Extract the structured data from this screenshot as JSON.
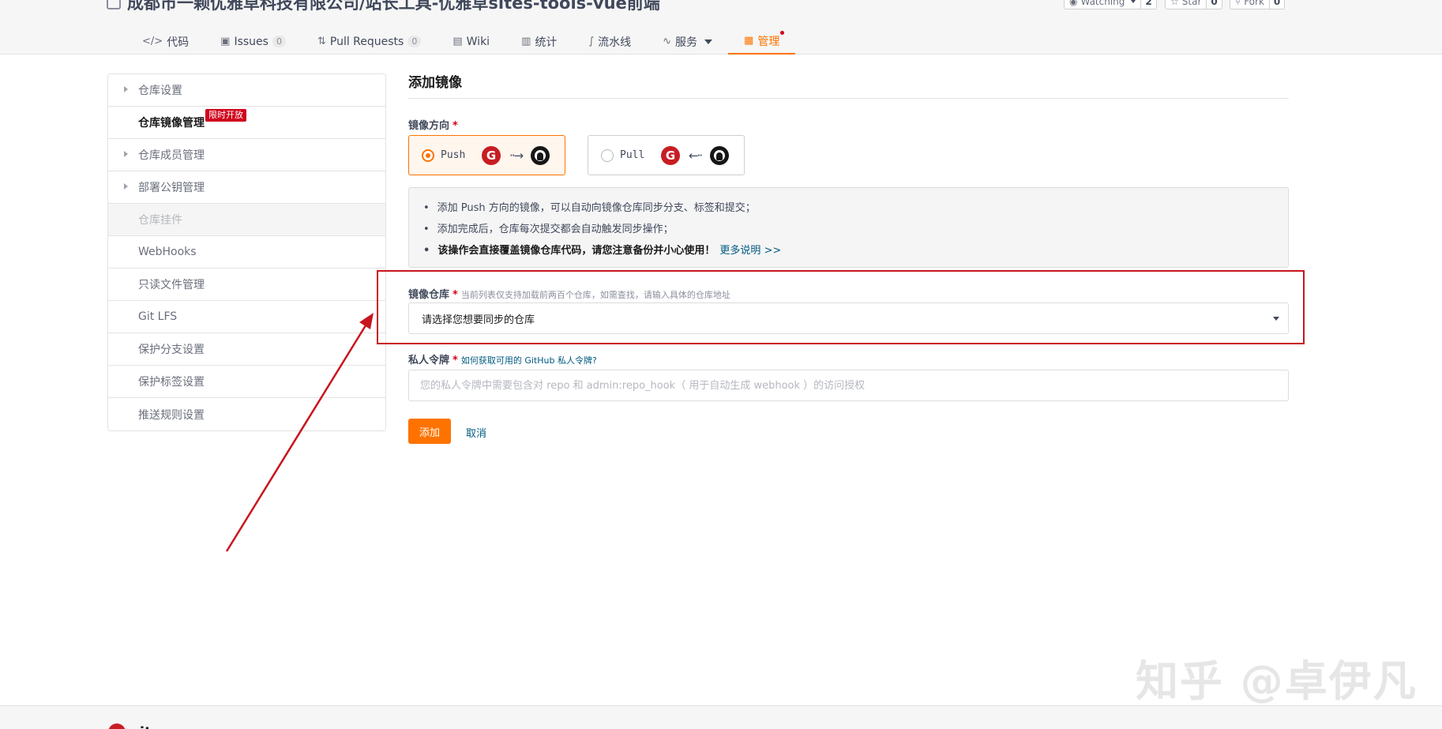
{
  "header": {
    "repo_title": "成都市一颗优雅草科技有限公司/站长工具-优雅草sites-tools-vue前端",
    "watching": {
      "label": "Watching",
      "count": "2"
    },
    "star": {
      "label": "Star",
      "count": "0"
    },
    "fork": {
      "label": "Fork",
      "count": "0"
    }
  },
  "tabs": [
    {
      "label": "代码",
      "icon": "code-icon"
    },
    {
      "label": "Issues",
      "icon": "issues-icon",
      "count": "0"
    },
    {
      "label": "Pull Requests",
      "icon": "pull-request-icon",
      "count": "0"
    },
    {
      "label": "Wiki",
      "icon": "wiki-icon"
    },
    {
      "label": "统计",
      "icon": "stats-icon"
    },
    {
      "label": "流水线",
      "icon": "pipeline-icon"
    },
    {
      "label": "服务",
      "icon": "service-icon"
    },
    {
      "label": "管理",
      "icon": "manage-icon",
      "active": true
    }
  ],
  "sidebar": {
    "items": [
      {
        "label": "仓库设置"
      },
      {
        "label": "仓库镜像管理",
        "badge": "限时开放"
      },
      {
        "label": "仓库成员管理"
      },
      {
        "label": "部署公钥管理"
      },
      {
        "label": "仓库挂件"
      },
      {
        "label": "WebHooks"
      },
      {
        "label": "只读文件管理"
      },
      {
        "label": "Git LFS"
      },
      {
        "label": "保护分支设置"
      },
      {
        "label": "保护标签设置"
      },
      {
        "label": "推送规则设置"
      }
    ]
  },
  "main": {
    "title": "添加镜像",
    "direction_label": "镜像方向",
    "push_label": "Push",
    "pull_label": "Pull",
    "info": [
      "添加 Push 方向的镜像，可以自动向镜像仓库同步分支、标签和提交；",
      "添加完成后，仓库每次提交都会自动触发同步操作；",
      "该操作会直接覆盖镜像仓库代码，请您注意备份并小心使用！"
    ],
    "info_more": "更多说明 >>",
    "repo_label": "镜像仓库",
    "repo_hint": "当前列表仅支持加载前两百个仓库，如需查找，请输入具体的仓库地址",
    "repo_select_value": "请选择您想要同步的仓库",
    "token_label": "私人令牌",
    "token_hint": "如何获取可用的 GitHub 私人令牌?",
    "token_placeholder": "您的私人令牌中需要包含对 repo 和 admin:repo_hook（ 用于自动生成 webhook ）的访问授权",
    "add_button": "添加",
    "cancel_button": "取消"
  },
  "watermark": "知乎 @卓伊凡",
  "footer": {
    "logo": "gitee"
  },
  "colors": {
    "accent": "#fe7300",
    "annotation": "#c9151e",
    "link": "#005980",
    "danger": "#d0021b"
  }
}
